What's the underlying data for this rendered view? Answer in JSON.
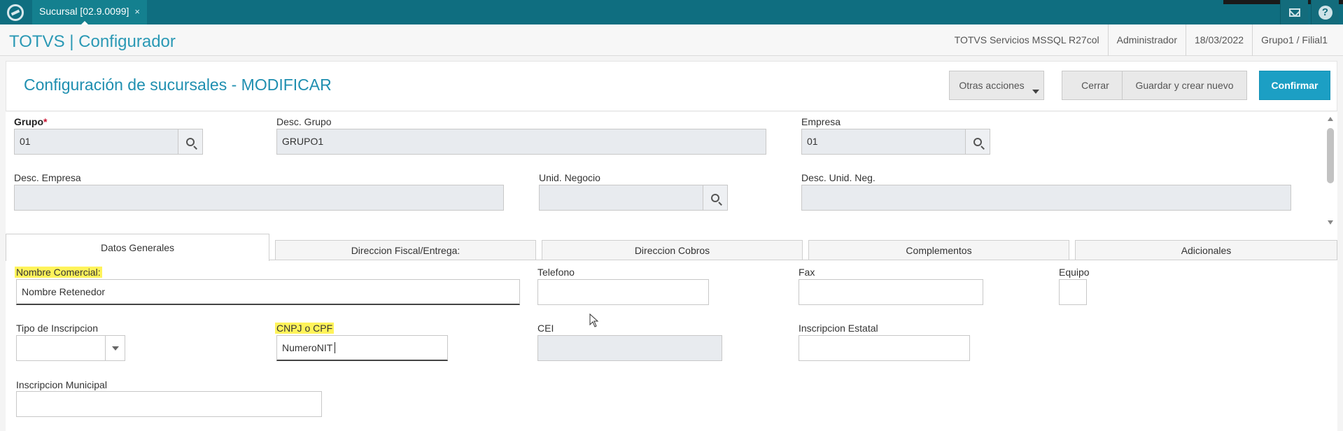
{
  "topbar": {
    "tab_label": "Sucursal [02.9.0099]",
    "tab_close": "×"
  },
  "header": {
    "app_title": "TOTVS | Configurador",
    "environment": "TOTVS Servicios MSSQL R27col",
    "user": "Administrador",
    "date": "18/03/2022",
    "branch": "Grupo1 / Filial1"
  },
  "page": {
    "title": "Configuración de sucursales - MODIFICAR",
    "buttons": {
      "otras": "Otras acciones",
      "cerrar": "Cerrar",
      "guardar": "Guardar y crear nuevo",
      "confirmar": "Confirmar"
    }
  },
  "fields": {
    "grupo": {
      "label": "Grupo",
      "required_mark": "*",
      "value": "01"
    },
    "desc_grupo": {
      "label": "Desc. Grupo",
      "value": "GRUPO1"
    },
    "empresa": {
      "label": "Empresa",
      "value": "01"
    },
    "desc_empresa": {
      "label": "Desc. Empresa",
      "value": ""
    },
    "unid_negocio": {
      "label": "Unid. Negocio",
      "value": ""
    },
    "desc_unid_neg": {
      "label": "Desc. Unid. Neg.",
      "value": ""
    }
  },
  "tabs": [
    {
      "label": "Datos Generales"
    },
    {
      "label": "Direccion Fiscal/Entrega:"
    },
    {
      "label": "Direccion Cobros"
    },
    {
      "label": "Complementos"
    },
    {
      "label": "Adicionales"
    }
  ],
  "general": {
    "nombre_comercial": {
      "label": "Nombre Comercial:",
      "value": "Nombre Retenedor"
    },
    "telefono": {
      "label": "Telefono",
      "value": ""
    },
    "fax": {
      "label": "Fax",
      "value": ""
    },
    "equipo": {
      "label": "Equipo",
      "value": ""
    },
    "tipo_inscripcion": {
      "label": "Tipo de Inscripcion",
      "value": ""
    },
    "cnpj_cpf": {
      "label": "CNPJ o CPF",
      "value": "NumeroNIT"
    },
    "cei": {
      "label": "CEI",
      "value": ""
    },
    "inscripcion_estatal": {
      "label": "Inscripcion Estatal",
      "value": ""
    },
    "inscripcion_municipal": {
      "label": "Inscripcion Municipal",
      "value": ""
    }
  },
  "colors": {
    "topbar": "#0f6e80",
    "accent": "#2b99b5",
    "confirm": "#1c9fc4",
    "highlight": "#fff35a"
  }
}
